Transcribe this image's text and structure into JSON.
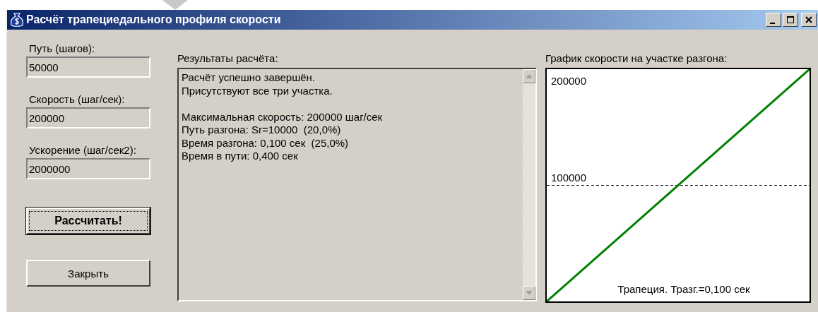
{
  "window": {
    "title": "Расчёт трапециедального профиля скорости",
    "controls": [
      {
        "kind": "minimize"
      },
      {
        "kind": "maximize"
      },
      {
        "kind": "close"
      }
    ]
  },
  "inputs": [
    {
      "label": "Путь (шагов):",
      "value": "50000"
    },
    {
      "label": "Скорость (шаг/сек):",
      "value": "200000"
    },
    {
      "label": "Ускорение (шаг/сек2):",
      "value": "2000000"
    }
  ],
  "buttons": [
    {
      "label": "Рассчитать!",
      "default": true
    },
    {
      "label": "Закрыть",
      "default": false
    }
  ],
  "results": {
    "label": "Результаты расчёта:",
    "paragraphs": [
      [
        "Расчёт успешно завершён.",
        "Присутствуют все три участка."
      ],
      [
        "Максимальная скорость: 200000 шаг/сек",
        "Путь разгона: Sr=10000  (20,0%)",
        "Время разгона: 0,100 сек  (25,0%)",
        "Время в пути: 0,400 сек"
      ]
    ]
  },
  "graph": {
    "title": "График скорости на участке разгона:",
    "top_label": "200000",
    "middle_label": "100000",
    "caption": "Трапеция. Тразг.=0,100 сек"
  }
}
